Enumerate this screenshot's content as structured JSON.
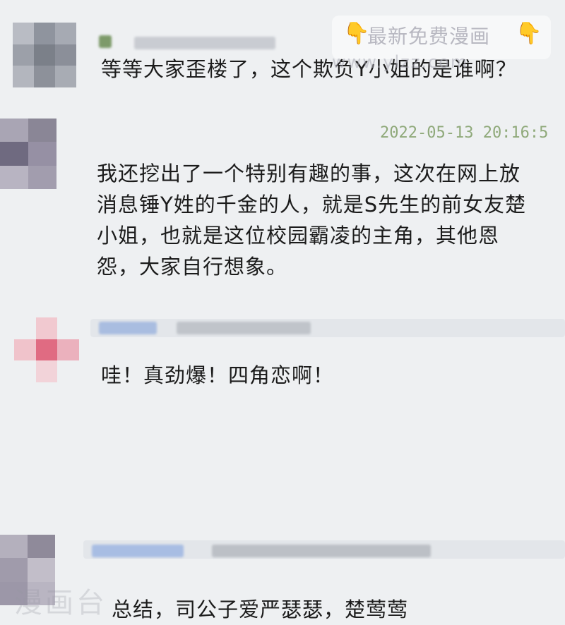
{
  "watermark": {
    "banner_text": "最新免费漫画",
    "left_icon": "pointing-down-hand-icon",
    "right_icon": "pointing-down-hand-icon",
    "url_text": "www.ylzz.com",
    "logo_text": "漫画台",
    "accent_color": "#f2b01e"
  },
  "comments": [
    {
      "body": "等等大家歪楼了，这个欺负Y小姐的是谁啊？",
      "timestamp": ""
    },
    {
      "body": "我还挖出了一个特别有趣的事，这次在网上放消息锤Y姓的千金的人，就是S先生的前女友楚小姐，也就是这位校园霸凌的主角，其他恩怨，大家自行想象。",
      "timestamp": "2022-05-13 20:16:5"
    },
    {
      "body": "哇！真劲爆！四角恋啊！",
      "timestamp": ""
    },
    {
      "body": "总结，司公子爱严瑟瑟，楚莺莺",
      "timestamp": ""
    }
  ]
}
